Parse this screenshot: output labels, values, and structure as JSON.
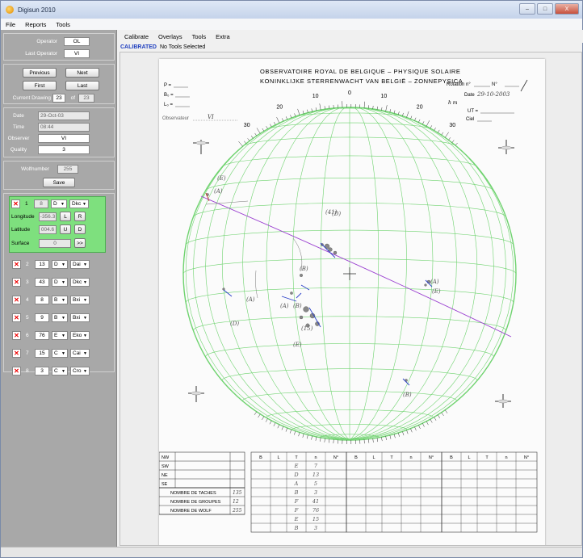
{
  "window": {
    "title": "Digisun 2010",
    "controls": [
      "–",
      "□",
      "X"
    ]
  },
  "menu": [
    "File",
    "Reports",
    "Tools"
  ],
  "operator": {
    "operator_label": "Operator",
    "operator_value": "OL",
    "last_operator_label": "Last Operator",
    "last_operator_value": "VI"
  },
  "navigation": {
    "previous": "Previous",
    "next": "Next",
    "first": "First",
    "last": "Last",
    "current_label": "Current Drawing",
    "current_value": "23",
    "of_label": "of",
    "total": "23"
  },
  "observation": {
    "date_label": "Date",
    "date_value": "29-Oct-03",
    "time_label": "Time",
    "time_value": "08:44",
    "observer_label": "Observer",
    "observer_value": "VI",
    "quality_label": "Quality",
    "quality_value": "3"
  },
  "wolf": {
    "label": "Wolfnumber",
    "value": "255",
    "save": "Save"
  },
  "selected_group": {
    "index": "1",
    "number": "8",
    "type": "D",
    "mcintosh": "Dkc",
    "longitude_label": "Longitude",
    "longitude_value": "-356.3",
    "btn_l": "L",
    "btn_r": "R",
    "latitude_label": "Latitude",
    "latitude_value": "004.6",
    "btn_u": "U",
    "btn_d": "D",
    "surface_label": "Surface",
    "surface_value": "0",
    "surface_btn": ">>"
  },
  "groups": [
    {
      "index": "2",
      "number": "13",
      "type": "D",
      "mcintosh": "Dai"
    },
    {
      "index": "3",
      "number": "43",
      "type": "D",
      "mcintosh": "Dkc"
    },
    {
      "index": "4",
      "number": "8",
      "type": "B",
      "mcintosh": "Bxi"
    },
    {
      "index": "5",
      "number": "9",
      "type": "B",
      "mcintosh": "Bxi"
    },
    {
      "index": "6",
      "number": "76",
      "type": "E",
      "mcintosh": "Eko"
    },
    {
      "index": "7",
      "number": "15",
      "type": "C",
      "mcintosh": "Cai"
    },
    {
      "index": "8",
      "number": "3",
      "type": "C",
      "mcintosh": "Cro"
    }
  ],
  "toolbar": [
    "Calibrate",
    "Overlays",
    "Tools",
    "Extra"
  ],
  "status": {
    "calibrated": "CALIBRATED",
    "message": "No Tools Selected"
  },
  "drawing": {
    "header_1": "OBSERVATOIRE ROYAL DE BELGIQUE – PHYSIQUE SOLAIRE",
    "header_2": "KONINKLIJKE STERRENWACHT VAN BELGIË – ZONNEPYSICA",
    "rotation_label": "Rotation n°",
    "n_label": "N°",
    "date_label": "Date",
    "date_hand": "29-10-2003",
    "hm_label": "h   m",
    "ut_label": "UT =",
    "ciel_label": "Ciel",
    "observateur_label": "Observateur",
    "observateur_hand": "VI",
    "p_label": "P =",
    "b0_label": "B₀ =",
    "l0_label": "L₀ =",
    "hemispheres": [
      "NW",
      "SW",
      "NE",
      "SE"
    ],
    "nombre_taches": "NOMBRE DE TACHES",
    "nombre_groupes": "NOMBRE DE GROUPES",
    "nombre_wolf": "NOMBRE DE WOLF",
    "taches_value": "135",
    "groupes_value": "12",
    "wolf_value": "255",
    "table_headers": [
      "B",
      "L",
      "T",
      "n",
      "N°"
    ],
    "hand_T": [
      "E",
      "D",
      "A",
      "B",
      "F",
      "F",
      "E",
      "B"
    ],
    "hand_n": [
      "7",
      "13",
      "5",
      "3",
      "41",
      "76",
      "15",
      "3"
    ],
    "labels": [
      "(E)",
      "(A)",
      "(E)",
      "(41)",
      "(A)",
      "(B)",
      "(D)",
      "(A)",
      "(15)",
      "(E)",
      "(B)",
      "(D)",
      "(A)",
      "(B)"
    ],
    "tick_numbers": [
      "30",
      "20",
      "10",
      "0",
      "10",
      "20",
      "30"
    ]
  },
  "colors": {
    "panel_gray": "#a8a8a8",
    "selected_green": "#7ee07e",
    "grid_green": "#6fd36f",
    "equator_purple": "#9a3fd0",
    "calibrated_blue": "#1f3fbf",
    "pen_blue": "#2a3fc8"
  }
}
